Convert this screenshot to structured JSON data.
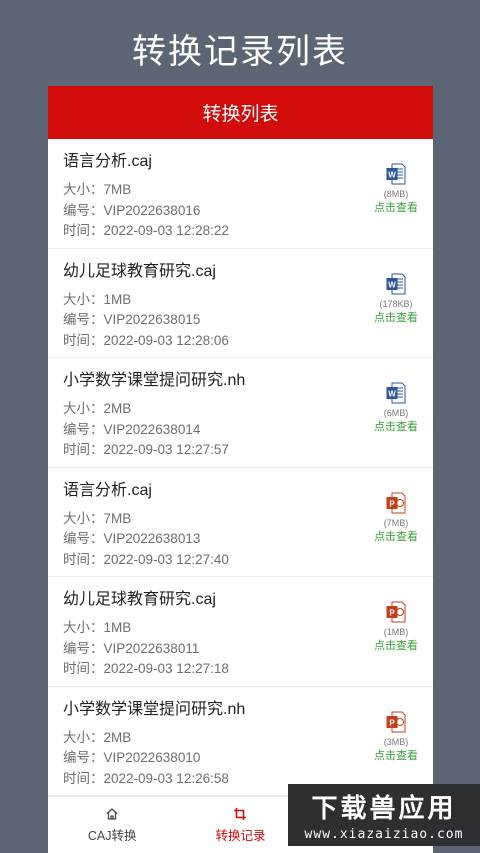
{
  "hero": {
    "title": "转换记录列表"
  },
  "card": {
    "title": "转换列表"
  },
  "labels": {
    "size": "大小：",
    "number": "编号：",
    "time": "时间："
  },
  "records": [
    {
      "name": "语言分析.caj",
      "size": "7MB",
      "number": "VIP2022638016",
      "time": "2022-09-03 12:28:22",
      "icon": "word-doc-icon",
      "out_size": "(8MB)",
      "action": "点击查看"
    },
    {
      "name": "幼儿足球教育研究.caj",
      "size": "1MB",
      "number": "VIP2022638015",
      "time": "2022-09-03 12:28:06",
      "icon": "word-doc-icon",
      "out_size": "(178KB)",
      "action": "点击查看"
    },
    {
      "name": "小学数学课堂提问研究.nh",
      "size": "2MB",
      "number": "VIP2022638014",
      "time": "2022-09-03 12:27:57",
      "icon": "word-doc-icon",
      "out_size": "(6MB)",
      "action": "点击查看"
    },
    {
      "name": "语言分析.caj",
      "size": "7MB",
      "number": "VIP2022638013",
      "time": "2022-09-03 12:27:40",
      "icon": "ppt-doc-icon",
      "out_size": "(7MB)",
      "action": "点击查看"
    },
    {
      "name": "幼儿足球教育研究.caj",
      "size": "1MB",
      "number": "VIP2022638011",
      "time": "2022-09-03 12:27:18",
      "icon": "ppt-doc-icon",
      "out_size": "(1MB)",
      "action": "点击查看"
    },
    {
      "name": "小学数学课堂提问研究.nh",
      "size": "2MB",
      "number": "VIP2022638010",
      "time": "2022-09-03 12:26:58",
      "icon": "ppt-doc-icon",
      "out_size": "(3MB)",
      "action": "点击查看"
    }
  ],
  "tabs": [
    {
      "label": "CAJ转换",
      "icon": "home-icon",
      "active": false
    },
    {
      "label": "转换记录",
      "icon": "crop-icon",
      "active": true
    }
  ],
  "watermark": {
    "top": "下载兽应用",
    "bottom": "www.xiazaiziao.com"
  },
  "colors": {
    "background": "#5b6573",
    "accent": "#d10a0a",
    "link": "#3aa13a",
    "word": "#2b579a",
    "ppt": "#c43e1c"
  }
}
